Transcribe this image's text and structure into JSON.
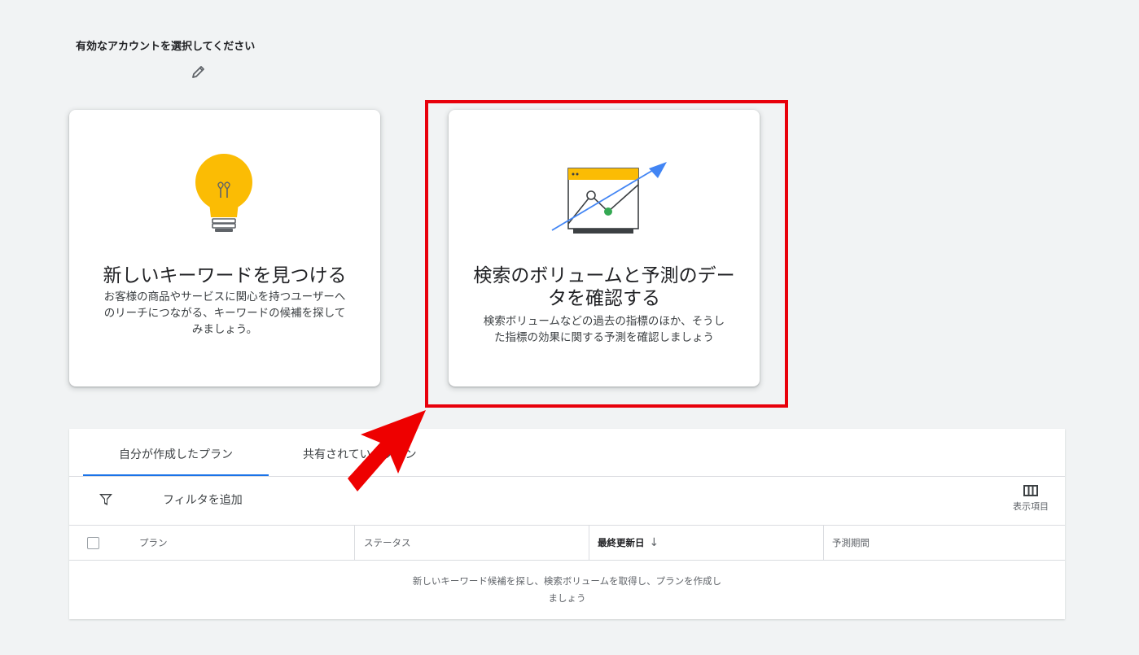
{
  "header": {
    "account_prompt": "有効なアカウントを選択してください",
    "edit_icon": "pencil-icon"
  },
  "cards": [
    {
      "icon": "lightbulb-icon",
      "title": "新しいキーワードを見つける",
      "desc_lines": [
        "お客様の商品やサービスに関心を持つユーザーへ",
        "のリーチにつながる、キーワードの候補を探して",
        "みましょう。"
      ]
    },
    {
      "icon": "trend-chart-icon",
      "title_lines": [
        "検索のボリュームと予測のデー",
        "タを確認する"
      ],
      "desc_lines": [
        "検索ボリュームなどの過去の指標のほか、そうし",
        "た指標の効果に関する予測を確認しましょう"
      ]
    }
  ],
  "plans": {
    "tabs": [
      {
        "label": "自分が作成したプラン",
        "active": true
      },
      {
        "label": "共有されているプラン",
        "active": false
      }
    ],
    "filter": {
      "icon": "filter-icon",
      "label": "フィルタを追加"
    },
    "columns_button": {
      "icon": "columns-icon",
      "label": "表示項目"
    },
    "table": {
      "headers": [
        "プラン",
        "ステータス",
        "最終更新日",
        "予測期間"
      ],
      "sort_icon": "arrow-down-icon",
      "empty_lines": [
        "新しいキーワード候補を探し、検索ボリュームを取得し、プランを作成し",
        "ましょう"
      ]
    }
  },
  "colors": {
    "highlight": "#e8000b",
    "accent_blue": "#1a73e8",
    "bulb_yellow": "#fbbc04",
    "chart_green": "#34a853",
    "arrow_blue": "#4285f4"
  }
}
